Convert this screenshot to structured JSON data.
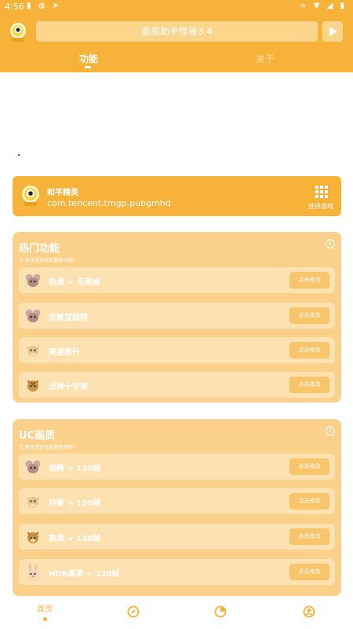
{
  "status_bar": {
    "time": "4:56",
    "left_icons": [
      "sd-card-icon",
      "notification-bell-icon",
      "location-arrow-icon"
    ],
    "right_icons": [
      "link-icon",
      "wifi-icon",
      "signal-icon",
      "battery-icon"
    ]
  },
  "header": {
    "title": "画质助手怪兽3.4",
    "tabs": [
      {
        "label": "功能",
        "active": true
      },
      {
        "label": "关于",
        "active": false
      }
    ]
  },
  "game": {
    "name": "和平精英",
    "package": "com.tencent.tmgp.pubgmhd",
    "choose_label": "选择游戏"
  },
  "sections": [
    {
      "title": "热门功能",
      "subtitle": "注:每次进游戏前需修改哦!",
      "rows": [
        {
          "label": "极清 + 无限帧",
          "button": "点击修改",
          "icon": "mouse-icon"
        },
        {
          "label": "灵敏度超频",
          "button": "点击修改",
          "icon": "mouse-icon"
        },
        {
          "label": "亮度提升",
          "button": "点击修改",
          "icon": "cow-icon"
        },
        {
          "label": "战神十字架",
          "button": "点击修改",
          "icon": "tiger-icon"
        }
      ]
    },
    {
      "title": "UC画质",
      "subtitle": "注:每次进游戏前需修改哦!",
      "rows": [
        {
          "label": "流畅 + 120帧",
          "button": "点击修改",
          "icon": "mouse-icon"
        },
        {
          "label": "均衡 + 120帧",
          "button": "点击修改",
          "icon": "cow-icon"
        },
        {
          "label": "高清 + 120帧",
          "button": "点击修改",
          "icon": "tiger-icon"
        },
        {
          "label": "HDR高清 + 120帧",
          "button": "点击修改",
          "icon": "rabbit-icon"
        }
      ]
    }
  ],
  "bottom_nav": {
    "home_label": "首页",
    "items": [
      "home-icon",
      "compass-icon",
      "chart-icon",
      "profile-icon"
    ]
  },
  "colors": {
    "accent": "#f7b23a",
    "section_bg": "#fbd08a",
    "row_bg": "#fde1b0",
    "button_bg": "#f8c56a"
  }
}
